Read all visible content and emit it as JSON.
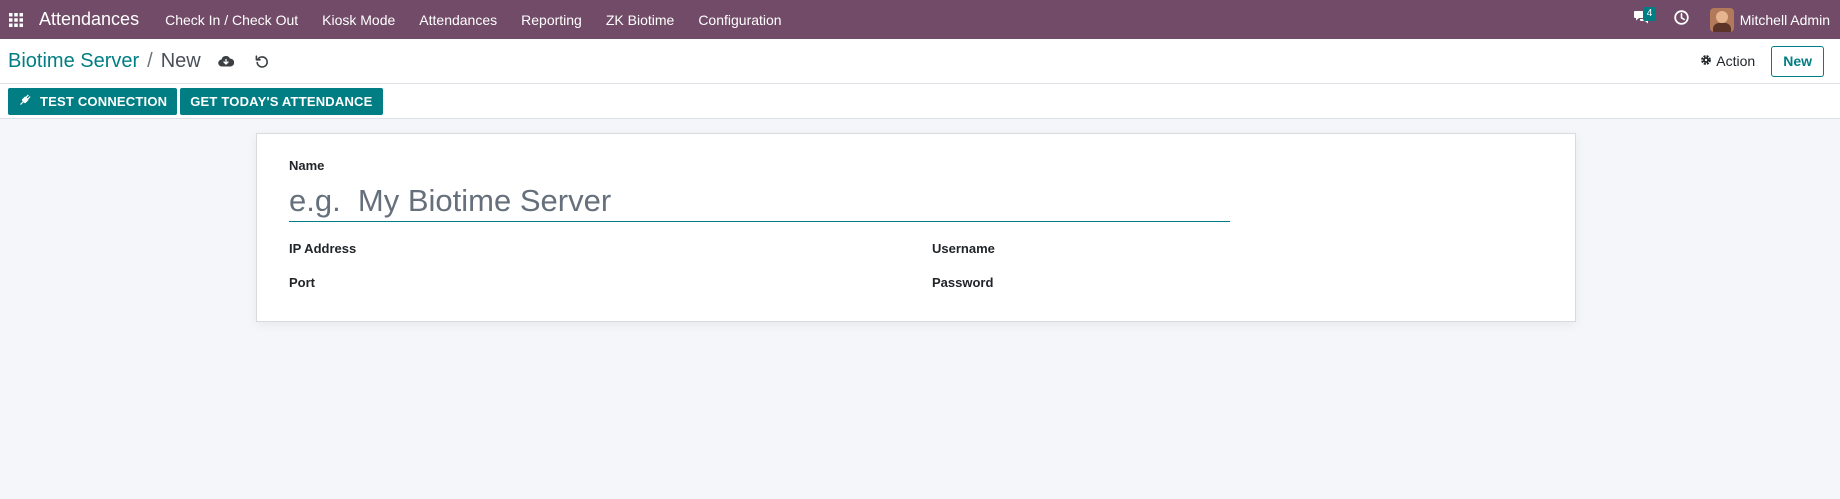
{
  "navbar": {
    "app_name": "Attendances",
    "menu": [
      {
        "label": "Check In / Check Out"
      },
      {
        "label": "Kiosk Mode"
      },
      {
        "label": "Attendances"
      },
      {
        "label": "Reporting"
      },
      {
        "label": "ZK Biotime"
      },
      {
        "label": "Configuration"
      }
    ],
    "messages_badge": "4",
    "user_name": "Mitchell Admin",
    "bg_color": "#714b67"
  },
  "control_panel": {
    "breadcrumb_parent": "Biotime Server",
    "breadcrumb_sep": "/",
    "breadcrumb_current": "New",
    "action_label": "Action",
    "new_label": "New"
  },
  "header_buttons": {
    "test_connection": "TEST CONNECTION",
    "get_attendance": "GET TODAY'S ATTENDANCE",
    "accent_color": "#017e84"
  },
  "form": {
    "name_label": "Name",
    "name_placeholder": "e.g.  My Biotime Server",
    "name_value": "",
    "ip_address_label": "IP Address",
    "port_label": "Port",
    "username_label": "Username",
    "password_label": "Password"
  }
}
